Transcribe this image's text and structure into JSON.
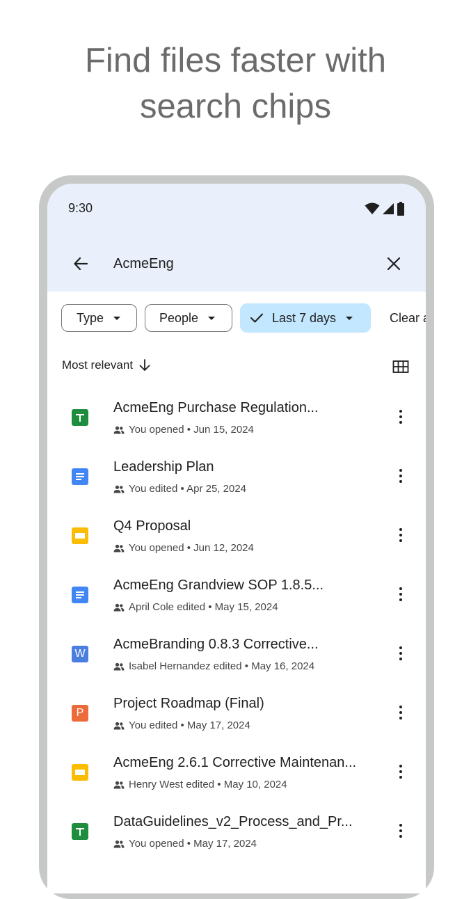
{
  "headline": {
    "line1": "Find files faster with",
    "line2": "search chips"
  },
  "status_bar": {
    "time": "9:30",
    "icons": [
      "wifi-icon",
      "cellular-icon",
      "battery-icon"
    ]
  },
  "search": {
    "query": "AcmeEng"
  },
  "chips": {
    "type": "Type",
    "people": "People",
    "date": "Last 7 days",
    "clear": "Clear all"
  },
  "sort": {
    "label": "Most relevant"
  },
  "colors": {
    "topbar_bg": "#e9f0fb",
    "selected_chip": "#c2e7ff",
    "sheets": "#1e8e3e",
    "docs": "#4285f4",
    "slides": "#fbbc04",
    "word": "#4a7fe0",
    "powerpoint": "#ed6a3a"
  },
  "files": [
    {
      "title": "AcmeEng Purchase Regulation...",
      "meta": "You opened • Jun 15, 2024",
      "kind": "sheets"
    },
    {
      "title": "Leadership Plan",
      "meta": "You edited • Apr 25, 2024",
      "kind": "docs"
    },
    {
      "title": "Q4 Proposal",
      "meta": "You opened • Jun 12, 2024",
      "kind": "slides"
    },
    {
      "title": "AcmeEng Grandview SOP 1.8.5...",
      "meta": "April Cole edited • May 15, 2024",
      "kind": "docs"
    },
    {
      "title": "AcmeBranding 0.8.3 Corrective...",
      "meta": "Isabel Hernandez edited • May 16, 2024",
      "kind": "word",
      "letter": "W"
    },
    {
      "title": "Project Roadmap (Final)",
      "meta": "You edited • May 17, 2024",
      "kind": "powerpoint",
      "letter": "P"
    },
    {
      "title": "AcmeEng 2.6.1 Corrective Maintenan...",
      "meta": "Henry West edited • May 10, 2024",
      "kind": "slides"
    },
    {
      "title": "DataGuidelines_v2_Process_and_Pr...",
      "meta": "You opened • May 17, 2024",
      "kind": "sheets"
    }
  ]
}
